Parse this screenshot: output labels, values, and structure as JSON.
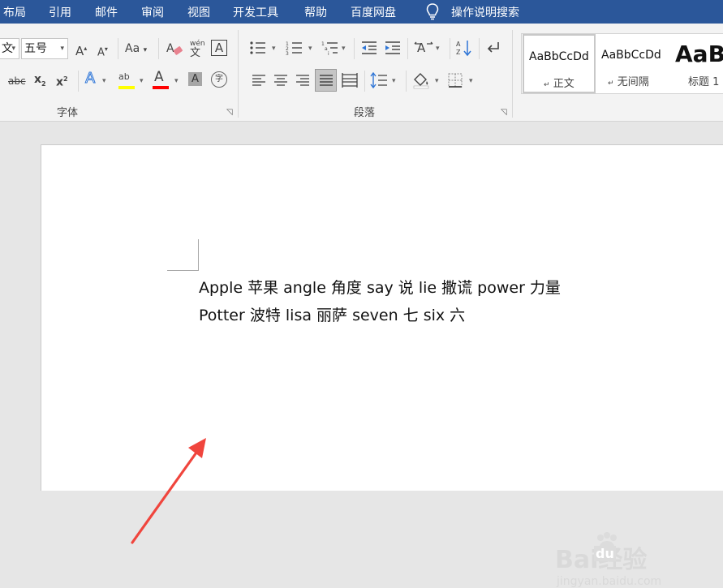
{
  "menu": {
    "tabs": [
      "布局",
      "引用",
      "邮件",
      "审阅",
      "视图",
      "开发工具",
      "帮助",
      "百度网盘"
    ],
    "tell_me": "操作说明搜索"
  },
  "ribbon": {
    "font_name": "文",
    "font_size": "五号",
    "grow_font": "A",
    "shrink_font": "A",
    "change_case": "Aa",
    "phonetic_top": "wén",
    "phonetic_bottom": "文",
    "char_border": "A",
    "strikethrough": "abc",
    "subscript": "x",
    "superscript": "x",
    "subscript_mark": "2",
    "superscript_mark": "2",
    "highlight_label": "ab",
    "font_color_label": "A",
    "char_shading": "A",
    "enclose_char": "字",
    "font_group_label": "字体",
    "paragraph_group_label": "段落",
    "highlight_color": "#ffff00",
    "font_color": "#ff0000"
  },
  "styles": [
    {
      "sample": "AaBbCcDd",
      "name": "正文"
    },
    {
      "sample": "AaBbCcDd",
      "name": "无间隔"
    },
    {
      "sample": "AaB",
      "name": "标题 1"
    }
  ],
  "document": {
    "lines": [
      "Apple 苹果 angle 角度 say 说 lie 撒谎 power 力量",
      "Potter 波特 lisa 丽萨 seven 七 six 六"
    ]
  },
  "watermark": {
    "brand": "Bai经验",
    "brand_du": "du",
    "url": "jingyan.baidu.com"
  },
  "colors": {
    "menubar": "#2b579a",
    "arrow": "#f0453d"
  }
}
